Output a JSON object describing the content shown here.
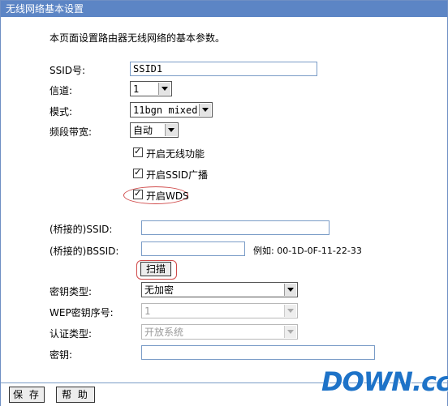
{
  "title": "无线网络基本设置",
  "intro": "本页面设置路由器无线网络的基本参数。",
  "form": {
    "ssid": {
      "label": "SSID号:",
      "value": "SSID1"
    },
    "channel": {
      "label": "信道:",
      "value": "1"
    },
    "mode": {
      "label": "模式:",
      "value": "11bgn mixed"
    },
    "bandwidth": {
      "label": "频段带宽:",
      "value": "自动"
    },
    "enable_wireless": {
      "label": "开启无线功能",
      "checked": true
    },
    "enable_ssid_broadcast": {
      "label": "开启SSID广播",
      "checked": true
    },
    "enable_wds": {
      "label": "开启WDS",
      "checked": true
    },
    "bridge_ssid": {
      "label": "(桥接的)SSID:",
      "value": ""
    },
    "bridge_bssid": {
      "label": "(桥接的)BSSID:",
      "value": "",
      "example": "例如: 00-1D-0F-11-22-33"
    },
    "scan_button": "扫描",
    "key_type": {
      "label": "密钥类型:",
      "value": "无加密"
    },
    "wep_index": {
      "label": "WEP密钥序号:",
      "value": "1"
    },
    "auth_type": {
      "label": "认证类型:",
      "value": "开放系统"
    },
    "key": {
      "label": "密钥:",
      "value": ""
    }
  },
  "footer": {
    "save": "保 存",
    "help": "帮 助"
  },
  "watermark": "DOWN.cc",
  "colors": {
    "titlebar": "#5c85c5",
    "highlight_oval": "#d04a4a",
    "logo_blue": "#1e73c8"
  }
}
